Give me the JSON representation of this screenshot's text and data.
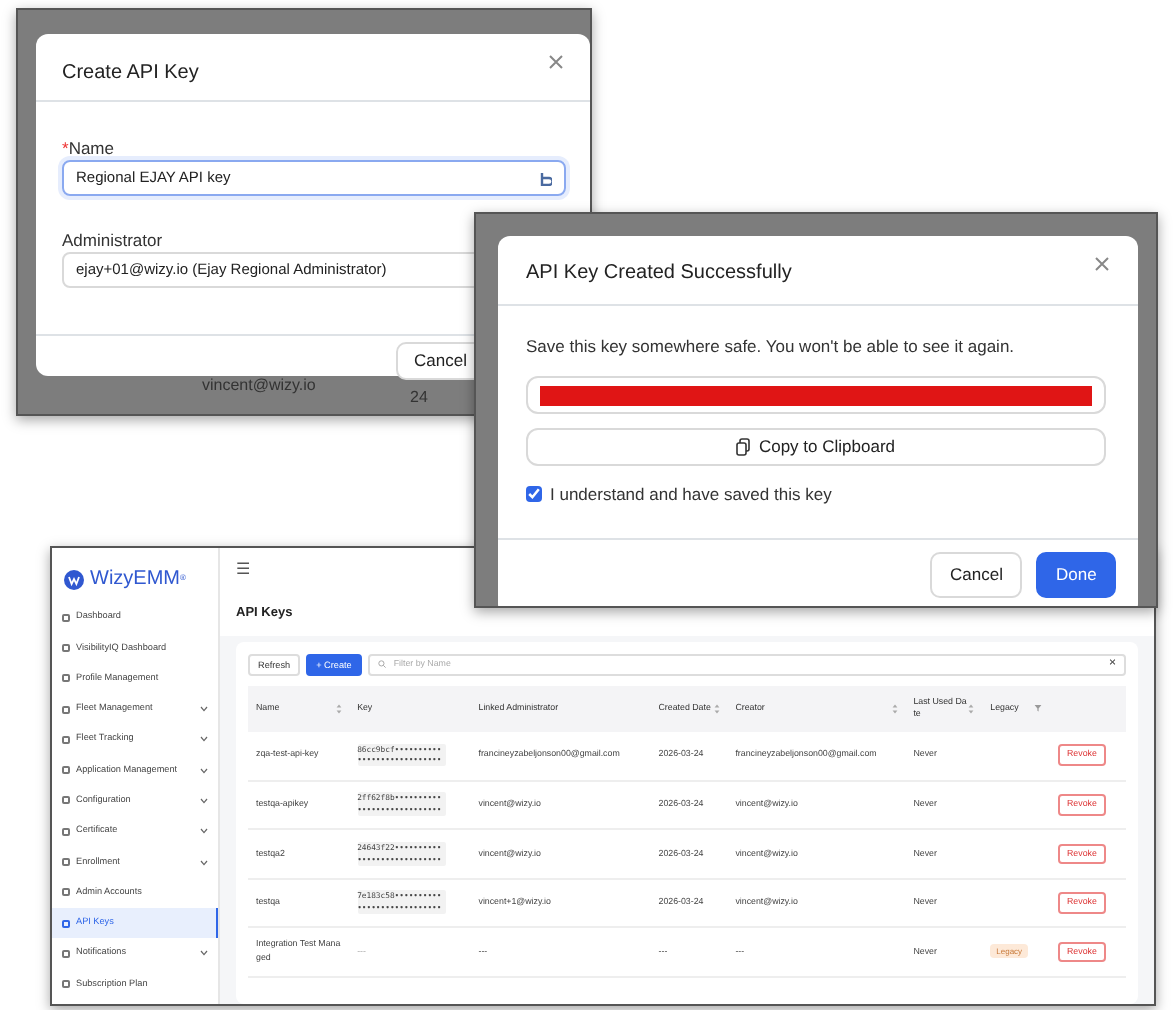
{
  "create_window": {
    "backdrop_fragments": [
      {
        "kind": "email",
        "text": "vincent@wizy.io"
      },
      {
        "kind": "date",
        "text": "24"
      }
    ],
    "dialog": {
      "title": "Create API Key",
      "required_mark": "*",
      "name_label": "Name",
      "name_value": "Regional EJAY API key",
      "admin_label": "Administrator",
      "admin_value": "ejay+01@wizy.io (Ejay Regional Administrator)",
      "cancel": "Cancel"
    }
  },
  "success_window": {
    "dialog": {
      "title": "API Key Created Successfully",
      "message": "Save this key somewhere safe. You won't be able to see it again.",
      "key_redacted": true,
      "copy_button": "Copy to Clipboard",
      "confirm_label": "I understand and have saved this key",
      "confirmed": true,
      "cancel": "Cancel",
      "done": "Done"
    }
  },
  "app": {
    "logo": "WizyEMM",
    "logo_mark": "®",
    "menu_icon": "☰",
    "sidebar": [
      {
        "label": "Dashboard",
        "expandable": false,
        "selected": false
      },
      {
        "label": "VisibilityIQ Dashboard",
        "expandable": false,
        "selected": false
      },
      {
        "label": "Profile Management",
        "expandable": false,
        "selected": false
      },
      {
        "label": "Fleet Management",
        "expandable": true,
        "selected": false
      },
      {
        "label": "Fleet Tracking",
        "expandable": true,
        "selected": false
      },
      {
        "label": "Application Management",
        "expandable": true,
        "selected": false
      },
      {
        "label": "Configuration",
        "expandable": true,
        "selected": false
      },
      {
        "label": "Certificate",
        "expandable": true,
        "selected": false
      },
      {
        "label": "Enrollment",
        "expandable": true,
        "selected": false
      },
      {
        "label": "Admin Accounts",
        "expandable": false,
        "selected": false
      },
      {
        "label": "API Keys",
        "expandable": false,
        "selected": true
      },
      {
        "label": "Notifications",
        "expandable": true,
        "selected": false
      },
      {
        "label": "Subscription Plan",
        "expandable": false,
        "selected": false
      }
    ],
    "page_title": "API Keys",
    "toolbar": {
      "refresh": "Refresh",
      "create": "Create",
      "create_icon": "+",
      "filter_placeholder": "Filter by Name",
      "clear_icon": "×"
    },
    "table": {
      "columns": [
        {
          "label": "Name",
          "sortable": true,
          "filterable": false
        },
        {
          "label": "Key",
          "sortable": false,
          "filterable": false
        },
        {
          "label": "Linked Administrator",
          "sortable": false,
          "filterable": false
        },
        {
          "label": "Created Date",
          "sortable": true,
          "filterable": false
        },
        {
          "label": "Creator",
          "sortable": true,
          "filterable": false
        },
        {
          "label": "Last Used Date",
          "sortable": true,
          "filterable": false
        },
        {
          "label": "Legacy",
          "sortable": false,
          "filterable": true
        }
      ],
      "rows": [
        {
          "name": "zqa-test-api-key",
          "key": "86cc9bcf••••••••••••••••••••••••••••",
          "admin": "francineyzabeljonson00@gmail.com",
          "created": "2026-03-24",
          "creator": "francineyzabeljonson00@gmail.com",
          "last_used": "Never",
          "action": "Revoke"
        },
        {
          "name": "testqa-apikey",
          "key": "2ff62f8b••••••••••••••••••••••••••••",
          "admin": "vincent@wizy.io",
          "created": "2026-03-24",
          "creator": "vincent@wizy.io",
          "last_used": "Never",
          "action": "Revoke"
        },
        {
          "name": "testqa2",
          "key": "24643f22••••••••••••••••••••••••••••",
          "admin": "vincent@wizy.io",
          "created": "2026-03-24",
          "creator": "vincent@wizy.io",
          "last_used": "Never",
          "action": "Revoke"
        },
        {
          "name": "testqa",
          "key": "7e183c58••••••••••••••••••••••••••••",
          "admin": "vincent+1@wizy.io",
          "created": "2026-03-24",
          "creator": "vincent@wizy.io",
          "last_used": "Never",
          "action": "Revoke"
        },
        {
          "name": "Integration Test Managed",
          "key": "---",
          "admin": "---",
          "created": "---",
          "creator": "---",
          "last_used": "Never",
          "legacy_tag": "Legacy",
          "action": "Revoke"
        }
      ]
    }
  }
}
